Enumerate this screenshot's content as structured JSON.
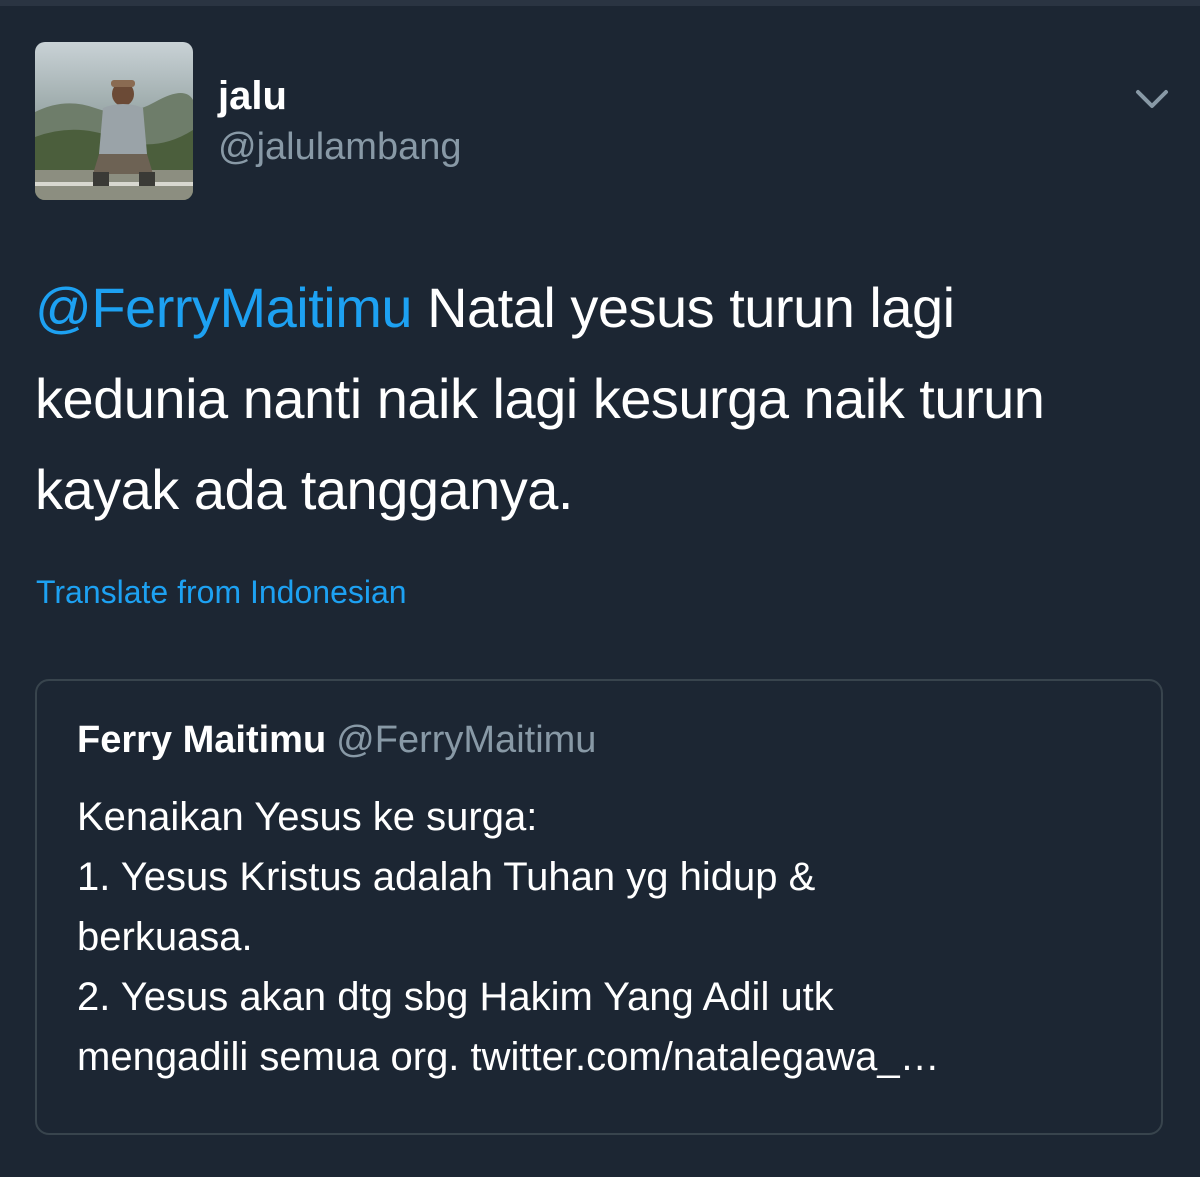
{
  "tweet": {
    "author": {
      "display_name": "jalu",
      "handle": "@jalulambang"
    },
    "mention": "@FerryMaitimu",
    "text_line1": " Natal yesus turun lagi",
    "text_line2": "kedunia nanti naik lagi kesurga naik turun",
    "text_line3": "kayak ada tangganya.",
    "translate_label": "Translate from Indonesian",
    "menu_icon": "chevron-down-icon"
  },
  "quoted_tweet": {
    "display_name": "Ferry Maitimu",
    "handle": "@FerryMaitimu",
    "lines": [
      "Kenaikan Yesus ke surga:",
      "1. Yesus Kristus adalah Tuhan yg hidup &",
      "berkuasa.",
      "2. Yesus akan dtg sbg Hakim Yang Adil utk",
      "mengadili semua org. twitter.com/natalegawa_…"
    ]
  },
  "colors": {
    "background": "#1c2633",
    "link": "#1da1f2",
    "secondary_text": "#8899a6",
    "border": "#38444d"
  }
}
